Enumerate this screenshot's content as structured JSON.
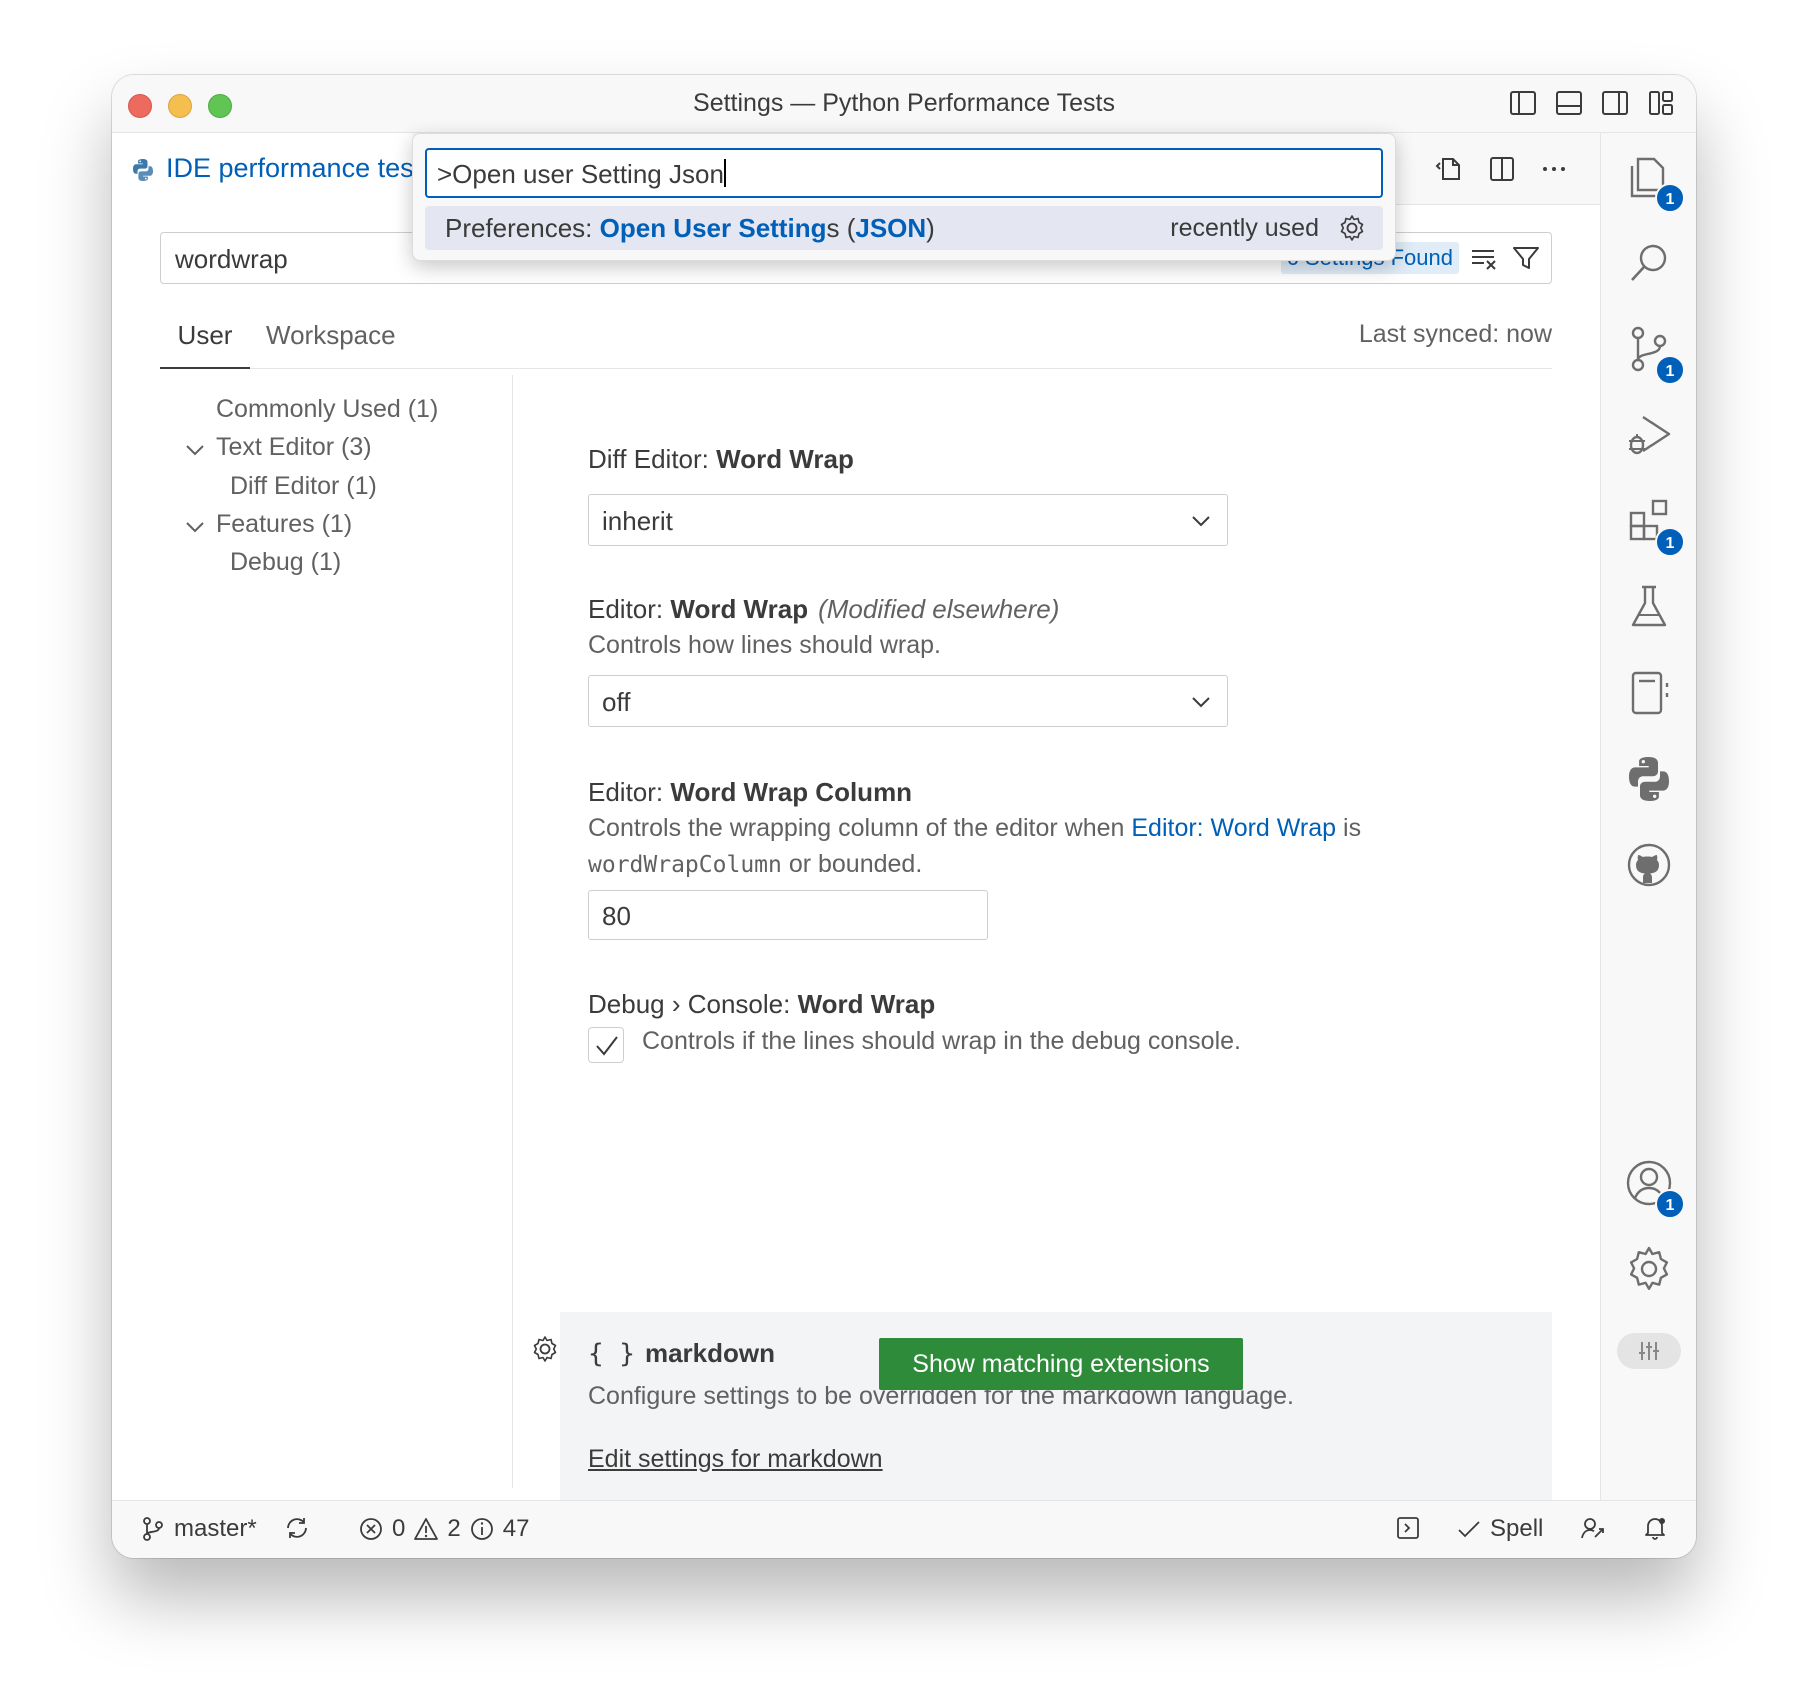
{
  "window": {
    "title": "Settings — Python Performance Tests"
  },
  "tab": {
    "label": "IDE performance tes"
  },
  "command_palette": {
    "input_value": ">Open user Setting Json",
    "result": {
      "prefix": "Preferences: ",
      "highlight1": "Open User Setting",
      "mid1": "s (",
      "highlight2": "JSON",
      "suffix": ")",
      "recently_used": "recently used"
    }
  },
  "search": {
    "value": "wordwrap",
    "found": "6 Settings Found"
  },
  "scopes": {
    "user": "User",
    "workspace": "Workspace",
    "last_synced": "Last synced: now"
  },
  "toc": [
    {
      "label": "Commonly Used (1)"
    },
    {
      "label": "Text Editor (3)"
    },
    {
      "label": "Diff Editor (1)"
    },
    {
      "label": "Features (1)"
    },
    {
      "label": "Debug (1)"
    }
  ],
  "settings": {
    "diff_wrap": {
      "category": "Diff Editor: ",
      "name": "Word Wrap",
      "value": "inherit"
    },
    "editor_wrap": {
      "category": "Editor: ",
      "name": "Word Wrap",
      "modified": "(Modified elsewhere)",
      "description": "Controls how lines should wrap.",
      "value": "off"
    },
    "wrap_column": {
      "category": "Editor: ",
      "name": "Word Wrap Column",
      "desc_part1": "Controls the wrapping column of the editor when ",
      "desc_link": "Editor: Word Wrap",
      "desc_part2": " is ",
      "desc_code": "wordWrapColumn",
      "desc_part3": " or bounded.",
      "value": "80"
    },
    "debug_wrap": {
      "category": "Debug › Console: ",
      "name": "Word Wrap",
      "description": "Controls if the lines should wrap in the debug console.",
      "checked": true
    },
    "markdown": {
      "braces": "{ }",
      "title": "markdown",
      "description": "Configure settings to be overridden for the markdown language.",
      "link": "Edit settings for markdown"
    }
  },
  "extensions_button": "Show matching extensions",
  "statusbar": {
    "branch": "master*",
    "errors": "0",
    "warnings": "2",
    "infos": "47",
    "spell": "Spell"
  },
  "activity_badges": {
    "explorer": "1",
    "scm": "1",
    "extensions": "1",
    "accounts": "1"
  },
  "colors": {
    "accent": "#005fb8",
    "button": "#2e8b3a",
    "badge": "#005fb8"
  }
}
